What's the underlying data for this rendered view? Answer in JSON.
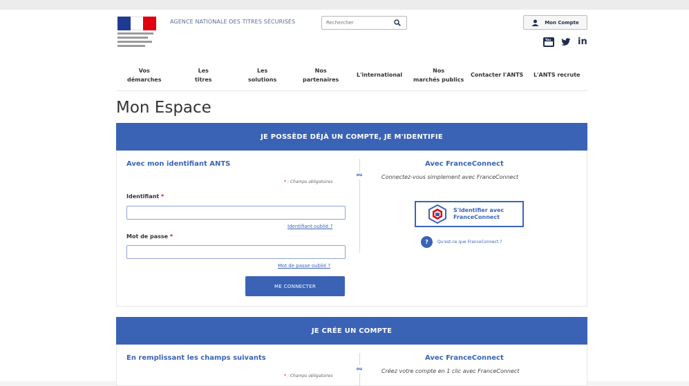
{
  "header": {
    "agency_name": "AGENCE NATIONALE DES TITRES SÉCURISÉS",
    "search_placeholder": "Rechercher",
    "account_button": "Mon Compte",
    "social": {
      "linkedin": "in"
    }
  },
  "nav": {
    "items": [
      {
        "line1": "Vos",
        "line2": "démarches"
      },
      {
        "line1": "Les",
        "line2": "titres"
      },
      {
        "line1": "Les",
        "line2": "solutions"
      },
      {
        "line1": "Nos",
        "line2": "partenaires"
      },
      {
        "line1": "L'international",
        "line2": ""
      },
      {
        "line1": "Nos",
        "line2": "marchés publics"
      },
      {
        "line1": "Contacter l'ANTS",
        "line2": ""
      },
      {
        "line1": "L'ANTS recrute",
        "line2": ""
      }
    ]
  },
  "page_title": "Mon Espace",
  "login": {
    "banner": "JE POSSÈDE DÉJÀ UN COMPTE, JE M'IDENTIFIE",
    "left_title": "Avec mon identifiant ANTS",
    "required_note": ": Champs obligatoires",
    "identifiant_label": "Identifiant",
    "identifiant_forgot": "Identifiant oublié ?",
    "password_label": "Mot de passe",
    "password_forgot": "Mot de passe oublié ?",
    "connect_button": "ME CONNECTER",
    "or_label": "ou",
    "fc_title": "Avec FranceConnect",
    "fc_subtitle": "Connectez-vous simplement avec FranceConnect",
    "fc_button_line1": "S'identifier avec",
    "fc_button_line2": "FranceConnect",
    "fc_help": "Qu'est-ce que FranceConnect ?"
  },
  "create": {
    "banner": "JE CRÉE UN COMPTE",
    "left_title": "En remplissant les champs suivants",
    "required_note": ": Champs obligatoires",
    "or_label": "ou",
    "fc_title": "Avec FranceConnect",
    "fc_subtitle": "Créez votre compte en 1 clic avec FranceConnect"
  },
  "colors": {
    "primary_blue": "#3a63b6",
    "required_red": "#e1000f",
    "nav_text": "#333333"
  },
  "icons": [
    "search-icon",
    "user-icon",
    "youtube-icon",
    "twitter-icon",
    "linkedin-icon",
    "franceconnect-logo-icon",
    "question-icon"
  ]
}
